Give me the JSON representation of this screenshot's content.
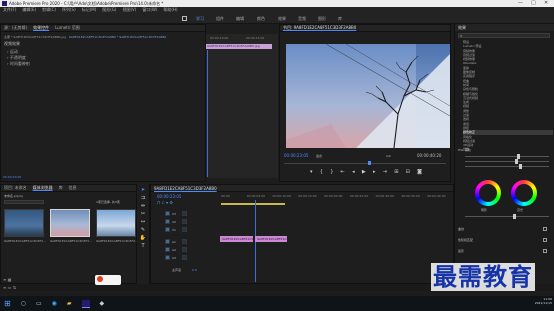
{
  "window": {
    "title": "Adobe Premiere Pro 2020 - C:\\用户\\Ado\\文档\\Adobe\\Premiere Pro\\14.0\\未命名 *",
    "controls": [
      "—",
      "□",
      "✕"
    ]
  },
  "menubar": [
    "文件(F)",
    "编辑(E)",
    "剪辑(C)",
    "序列(S)",
    "标记(M)",
    "图形(G)",
    "视图(V)",
    "窗口(W)",
    "帮助(H)"
  ],
  "workspace_tabs": [
    {
      "label": "学习",
      "active": true
    },
    {
      "label": "组件",
      "active": false
    },
    {
      "label": "编辑",
      "active": false
    },
    {
      "label": "颜色",
      "active": false
    },
    {
      "label": "效果",
      "active": false
    },
    {
      "label": "音频",
      "active": false
    },
    {
      "label": "图形",
      "active": false
    },
    {
      "label": "库",
      "active": false
    }
  ],
  "effect_controls": {
    "tabs": [
      "源：(无剪辑)",
      "效果控件",
      "Lumetri 范围"
    ],
    "active_tab": "效果控件",
    "source": "主要 * 9A8FD1E2CA8F51C3D3F2A8B0.jpg",
    "sequence": "9A8FD1E2CA8F51C3D3F2A8B0 * 9A8FD1E2CA8F51C3D3F2A8B0",
    "section_video": "视频效果",
    "items": [
      "运动",
      "不透明度",
      "时间重映射"
    ],
    "timecode_a": "00:00:23:05",
    "clip_label": "9A8FD1E2CA8F51C3D3F2A8B0.jpg",
    "mini_time": "00:00:10:00",
    "mini_time2": "00:00:15:00"
  },
  "program": {
    "tab": "节目: 9A8FD1E2CA8F51C3D3F2A8B0",
    "timecode": "00:00:23:05",
    "fit": "适合",
    "scale": "1/2",
    "duration": "00:00:40:20"
  },
  "right_panel": {
    "title": "效果",
    "search_placeholder": "",
    "tree": [
      "预设",
      "Lumetri 预设",
      "音频效果",
      "音频过渡",
      "视频效果",
      "Obsolete",
      "变换",
      "图像控制",
      "实用程序",
      "扭曲",
      "时间",
      "杂色与颗粒",
      "模糊与锐化",
      "沉浸式视频",
      "生成",
      "视频",
      "调整",
      "过渡",
      "透视",
      "通道",
      "键控",
      "颜色校正",
      "风格化",
      "视频过渡",
      "3D运动",
      "划像"
    ],
    "selected_item": "颜色校正",
    "hsl_label": "HSL 辅助",
    "wheel_labels": [
      "阴影",
      "中间调",
      "高光"
    ],
    "check_labels": [
      "曲线",
      "色轮和匹配",
      "晕影"
    ]
  },
  "project": {
    "tabs": [
      "项目: 未命名",
      "媒体浏览器",
      "库",
      "信息"
    ],
    "active_tab": "媒体浏览器",
    "file": "未命名.prproj",
    "count": "1项已选择, 共3项",
    "items": [
      {
        "label": "9A8FD1E2CA8F51C3D3F2...",
        "dur": "5:00"
      },
      {
        "label": "9A8FD1E2CA8F51C3D3F2...",
        "dur": "5:00"
      },
      {
        "label": "9A8FD1E2CA8F51C3D3F2...",
        "dur": "5:00"
      }
    ]
  },
  "timeline": {
    "tab": "9A8FD1E2CA8F51C3D3F2A8B0",
    "timecode": "00:00:23:05",
    "ruler": [
      "00:00",
      "00:00:05:00",
      "00:00:10:00",
      "00:00:15:00",
      "00:00:20:00",
      "00:00:25:00",
      "00:00:30:00",
      "00:00:35:00",
      "00:00:40:00"
    ],
    "video_tracks": [
      "V3",
      "V2",
      "V1"
    ],
    "audio_tracks": [
      "A1",
      "A2",
      "A3"
    ],
    "master": "主声道",
    "master_value": "0.0",
    "clips": [
      {
        "label": "9A8FD1E2CA8F51C3D3F2",
        "track": "V1"
      },
      {
        "label": "9A8FD1E2CA8F51C3D3F2",
        "track": "V1"
      }
    ]
  },
  "watermark": "最需教育",
  "taskbar": {
    "time": "11:06",
    "date": "2021/11/15"
  }
}
